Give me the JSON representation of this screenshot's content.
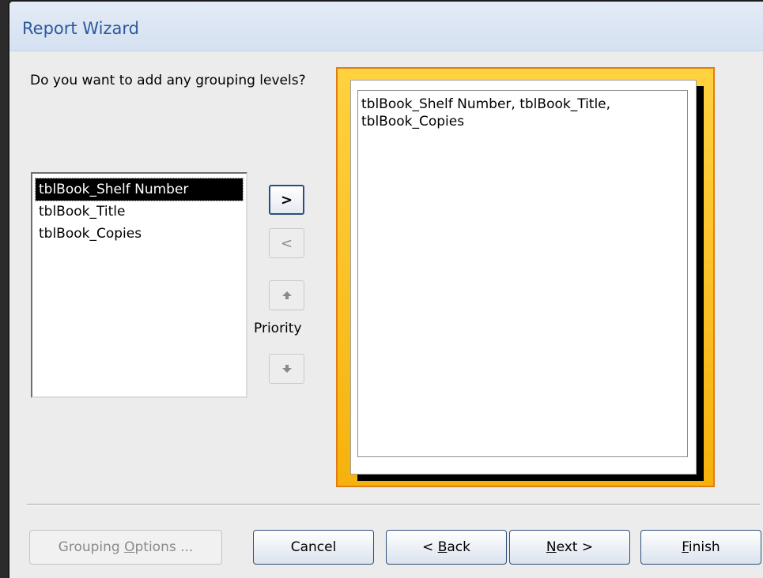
{
  "window": {
    "title": "Report Wizard"
  },
  "prompt": {
    "question": "Do you want to add any grouping levels?"
  },
  "fields": {
    "items": [
      "tblBook_Shelf Number",
      "tblBook_Title",
      "tblBook_Copies"
    ],
    "selected_index": 0
  },
  "move_buttons": {
    "add_label": ">",
    "remove_label": "<",
    "priority_label": "Priority"
  },
  "preview": {
    "text": "tblBook_Shelf Number, tblBook_Title, tblBook_Copies"
  },
  "buttons": {
    "grouping_options": {
      "pre": "Grouping ",
      "accel": "O",
      "post": "ptions ..."
    },
    "cancel": {
      "label": "Cancel"
    },
    "back": {
      "pre": "< ",
      "accel": "B",
      "post": "ack"
    },
    "next": {
      "pre": "",
      "accel": "N",
      "post": "ext >"
    },
    "finish": {
      "pre": "",
      "accel": "F",
      "post": "inish"
    }
  },
  "colors": {
    "title": "#2d5a9c",
    "preview_frame": "#f6b20c",
    "accent_border": "#2d4f7c"
  }
}
